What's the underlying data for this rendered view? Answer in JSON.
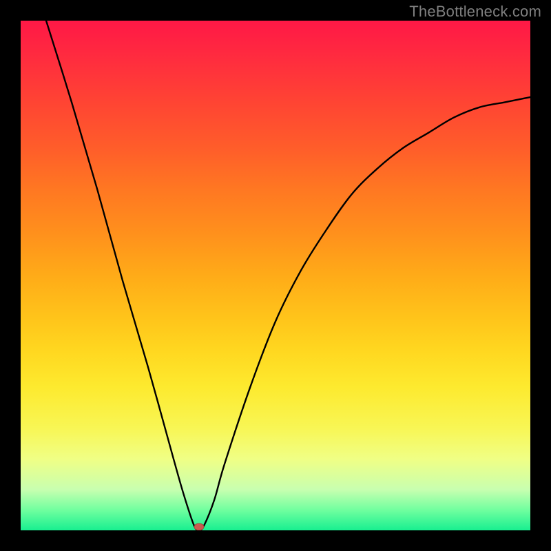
{
  "watermark": "TheBottleneck.com",
  "chart_data": {
    "type": "line",
    "title": "",
    "xlabel": "",
    "ylabel": "",
    "xlim": [
      0,
      100
    ],
    "ylim": [
      0,
      100
    ],
    "x": [
      5,
      10,
      15,
      20,
      25,
      30,
      32,
      34,
      35,
      36,
      38,
      40,
      45,
      50,
      55,
      60,
      65,
      70,
      75,
      80,
      85,
      90,
      95,
      100
    ],
    "values": [
      100,
      84,
      67,
      49,
      32,
      14,
      7,
      1,
      0,
      1,
      6,
      13,
      28,
      41,
      51,
      59,
      66,
      71,
      75,
      78,
      81,
      83,
      84,
      85
    ],
    "minimum_marker": {
      "x": 35,
      "y": 0
    }
  }
}
